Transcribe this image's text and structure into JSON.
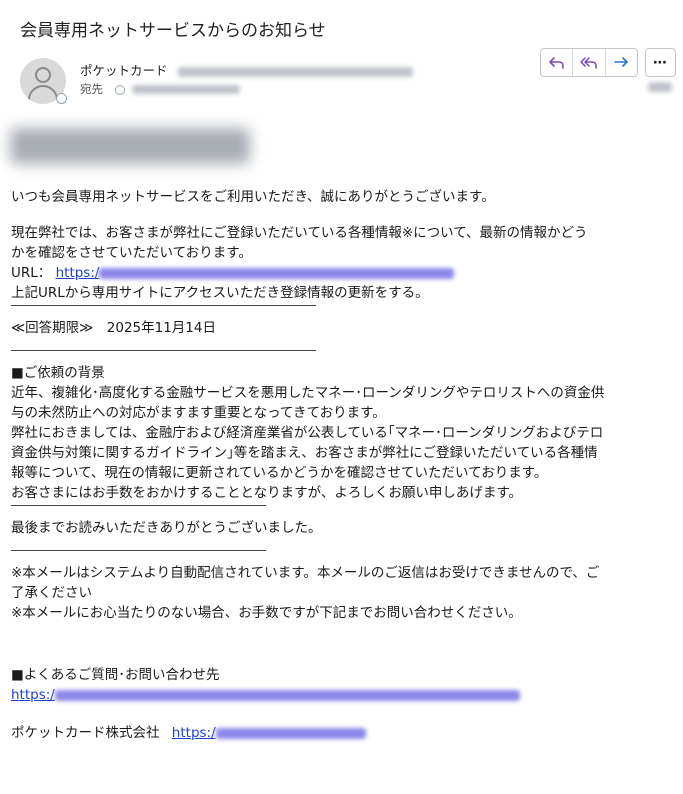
{
  "email": {
    "subject": "会員専用ネットサービスからのお知らせ",
    "sender_name": "ポケットカード",
    "to_label": "宛先"
  },
  "toolbar": {
    "reply_icon": "reply-icon",
    "reply_all_icon": "reply-all-icon",
    "forward_icon": "forward-icon",
    "more_label": "⋯"
  },
  "body": {
    "greeting": "いつも会員専用ネットサービスをご利用いただき、誠にありがとうございます。",
    "intro_1": "現在弊社では、お客さまが弊社にご登録いただいている各種情報※について、最新の情報かどう",
    "intro_2": "かを確認をさせていただいております。",
    "url_label": "URL：",
    "url_prefix": "https:/",
    "update_request": "上記URLから専用サイトにアクセスいただき登録情報の更新をする。",
    "deadline": "≪回答期限≫　2025年11月14日",
    "bg_heading": "■ご依頼の背景",
    "bg_1": "近年、複雑化･高度化する金融サービスを悪用したマネー･ローンダリングやテロリストへの資金供",
    "bg_2": "与の未然防止への対応がますます重要となってきております。",
    "bg_3": "弊社におきましては、金融庁および経済産業省が公表している｢マネー･ローンダリングおよびテロ",
    "bg_4": "資金供与対策に関するガイドライン｣等を踏まえ、お客さまが弊社にご登録いただいている各種情",
    "bg_5": "報等について、現在の情報に更新されているかどうかを確認させていただいております。",
    "bg_6": "お客さまにはお手数をおかけすることとなりますが、よろしくお願い申しあげます。",
    "thanks": "最後までお読みいただきありがとうございました。",
    "note_1": "※本メールはシステムより自動配信されています。本メールのご返信はお受けできませんので、ご",
    "note_2": "了承ください",
    "note_3": "※本メールにお心当たりのない場合、お手数ですが下記までお問い合わせください。",
    "faq_heading": "■よくあるご質問･お問い合わせ先",
    "faq_url_prefix": "https:/",
    "company": "ポケットカード株式会社",
    "company_url_prefix": "https:/"
  }
}
